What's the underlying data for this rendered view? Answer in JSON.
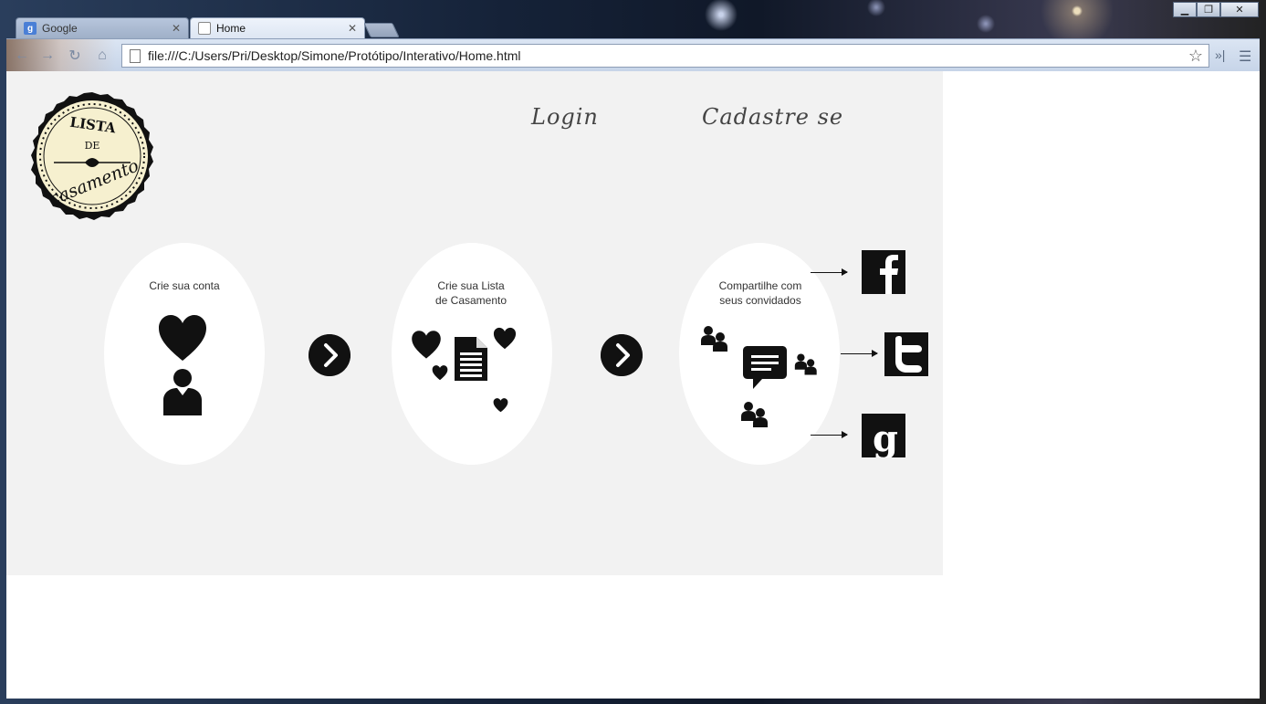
{
  "browser": {
    "tabs": [
      {
        "label": "Google",
        "favicon": "google-g-icon",
        "active": false
      },
      {
        "label": "Home",
        "favicon": "page-icon",
        "active": true
      }
    ],
    "address": "file:///C:/Users/Pri/Desktop/Simone/Protótipo/Interativo/Home.html",
    "window_controls": [
      "minimize",
      "maximize",
      "close"
    ]
  },
  "site": {
    "logo": {
      "line1": "LISTA",
      "line2": "DE",
      "line3": "casamento"
    },
    "nav": {
      "login": "Login",
      "signup": "Cadastre se"
    },
    "steps": [
      {
        "label": "Crie sua conta",
        "icons": [
          "heart-icon",
          "user-icon"
        ]
      },
      {
        "label": "Crie sua Lista\nde Casamento",
        "icons": [
          "heart-icon",
          "document-icon"
        ]
      },
      {
        "label": "Compartilhe com\nseus convidados",
        "icons": [
          "chat-bubble-icon",
          "users-icon"
        ]
      }
    ],
    "social": [
      "facebook",
      "twitter",
      "google-plus"
    ],
    "colors": {
      "page_bg": "#f2f2f2",
      "accent": "#111111",
      "logo_bg": "#f6f0cf"
    }
  }
}
